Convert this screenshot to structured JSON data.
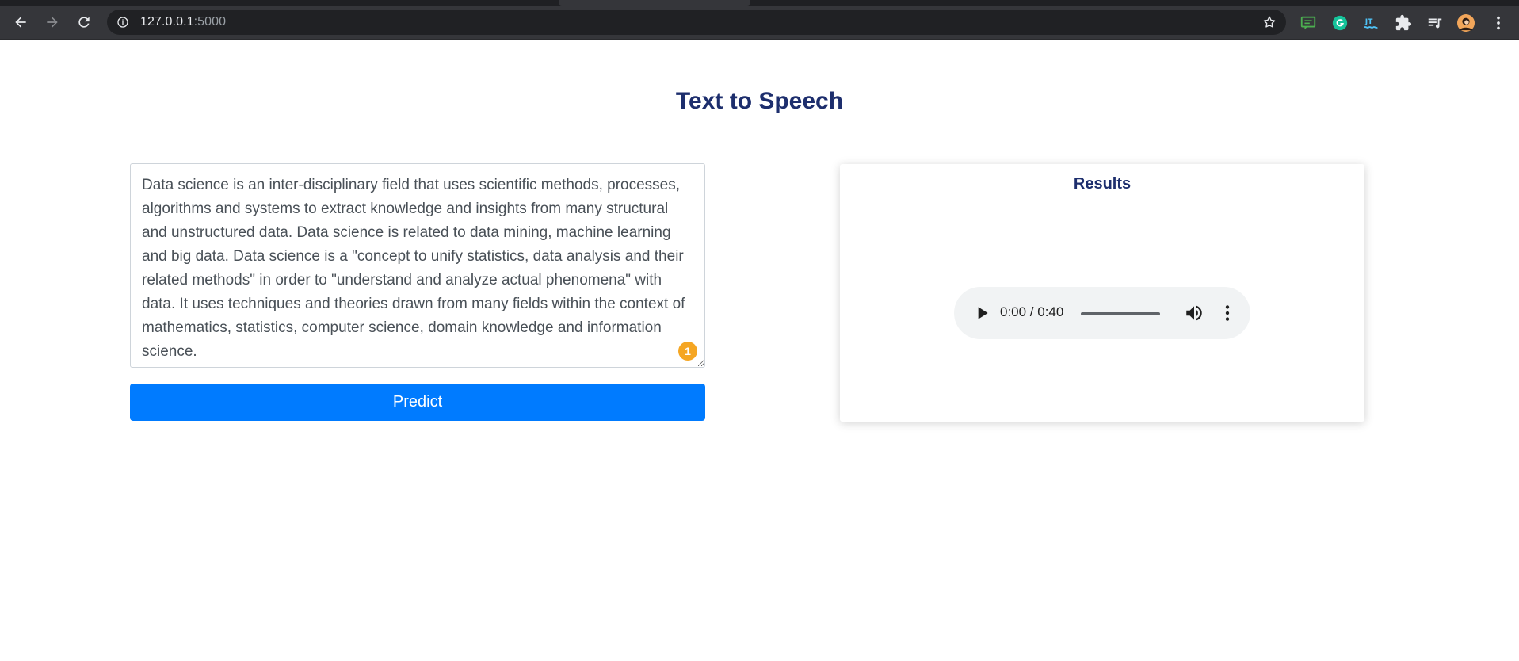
{
  "browser": {
    "url_host": "127.0.0.1",
    "url_port": ":5000"
  },
  "page": {
    "title": "Text to Speech",
    "textarea_value": "Data science is an inter-disciplinary field that uses scientific methods, processes, algorithms and systems to extract knowledge and insights from many structural and unstructured data. Data science is related to data mining, machine learning and big data. Data science is a \"concept to unify statistics, data analysis and their related methods\" in order to \"understand and analyze actual phenomena\" with data. It uses techniques and theories drawn from many fields within the context of mathematics, statistics, computer science, domain knowledge and information science.",
    "grammarly_count": "1",
    "predict_label": "Predict"
  },
  "results": {
    "title": "Results",
    "audio_time": "0:00 / 0:40"
  },
  "colors": {
    "title": "#1d2e6d",
    "button": "#007bff",
    "badge": "#f5a623"
  }
}
